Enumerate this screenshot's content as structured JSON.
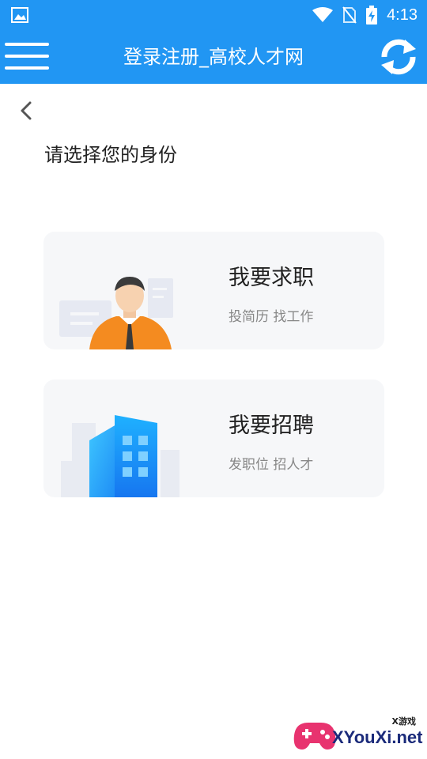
{
  "status_bar": {
    "time": "4:13"
  },
  "app_bar": {
    "title": "登录注册_高校人才网"
  },
  "page": {
    "heading": "请选择您的身份"
  },
  "cards": [
    {
      "title": "我要求职",
      "subtitle": "投简历 找工作"
    },
    {
      "title": "我要招聘",
      "subtitle": "发职位 招人才"
    }
  ],
  "watermark": {
    "brand": "XYouXi.net",
    "tag": "X游戏"
  }
}
